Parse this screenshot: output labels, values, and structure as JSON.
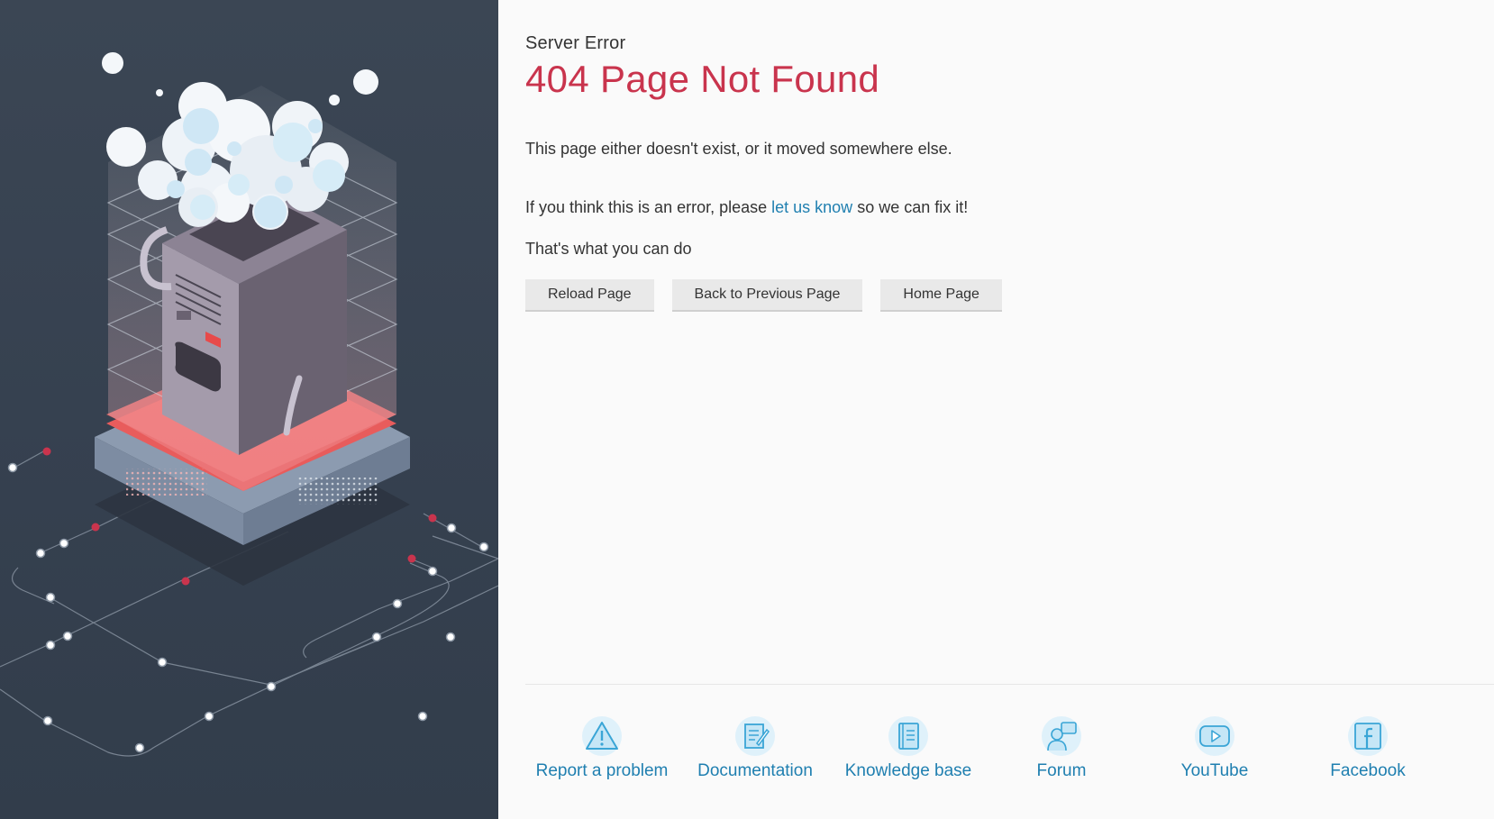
{
  "header": {
    "subtitle": "Server Error",
    "title": "404 Page Not Found"
  },
  "messages": {
    "line1": "This page either doesn't exist, or it moved somewhere else.",
    "line2_before": "If you think this is an error, please ",
    "line2_link": "let us know",
    "line2_after": " so we can fix it!",
    "line3": "That's what you can do"
  },
  "buttons": {
    "reload": "Reload Page",
    "back": "Back to Previous Page",
    "home": "Home Page"
  },
  "footer": {
    "items": [
      {
        "label": "Report a problem",
        "icon": "warning-icon"
      },
      {
        "label": "Documentation",
        "icon": "document-icon"
      },
      {
        "label": "Knowledge base",
        "icon": "book-icon"
      },
      {
        "label": "Forum",
        "icon": "forum-icon"
      },
      {
        "label": "YouTube",
        "icon": "youtube-icon"
      },
      {
        "label": "Facebook",
        "icon": "facebook-icon"
      }
    ]
  },
  "colors": {
    "title": "#c9344d",
    "link": "#1f7fb0",
    "left_panel": "#364150",
    "accent_red": "#e85c5c"
  }
}
